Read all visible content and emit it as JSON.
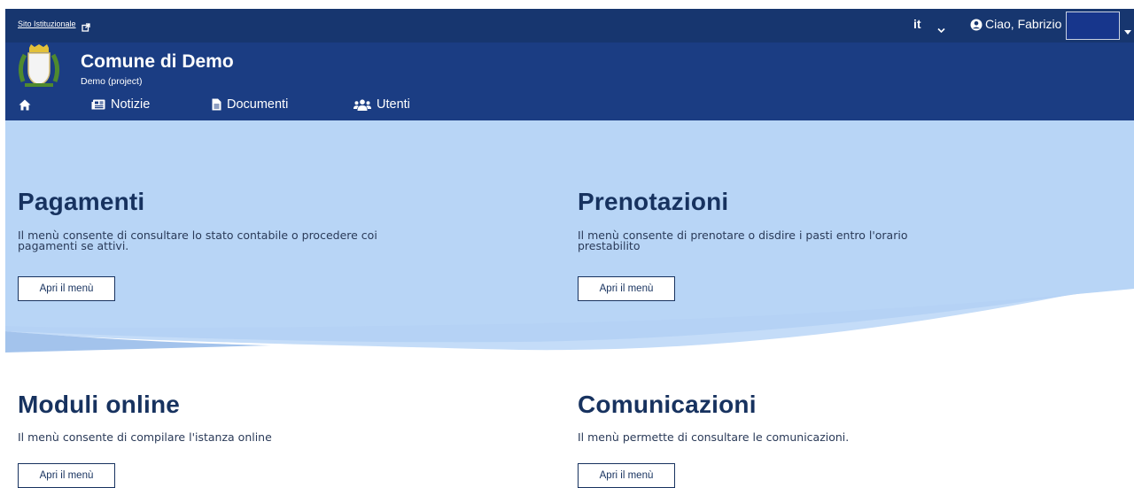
{
  "topbar": {
    "institutional_link": "Sito Istituzionale",
    "language": "it",
    "greeting": "Ciao, Fabrizio"
  },
  "header": {
    "title": "Comune di Demo",
    "subtitle": "Demo (project)",
    "nav": [
      {
        "label": "Notizie",
        "icon": "newspaper-icon"
      },
      {
        "label": "Documenti",
        "icon": "document-icon"
      },
      {
        "label": "Utenti",
        "icon": "users-icon"
      }
    ]
  },
  "cards": [
    {
      "title": "Pagamenti",
      "description_line1": "Il menù consente di consultare lo stato contabile o procedere coi",
      "description_line2": "pagamenti se attivi.",
      "button": "Apri il menù"
    },
    {
      "title": "Prenotazioni",
      "description_line1": "Il menù consente di prenotare o disdire i pasti entro l'orario",
      "description_line2": "prestabilito",
      "button": "Apri il menù"
    },
    {
      "title": "Moduli online",
      "description_line1": "Il menù consente di compilare l'istanza online",
      "description_line2": "",
      "button": "Apri il menù"
    },
    {
      "title": "Comunicazioni",
      "description_line1": "Il menù permette di consultare le comunicazioni.",
      "description_line2": "",
      "button": "Apri il menù"
    }
  ],
  "colors": {
    "top_bar": "#17366f",
    "header": "#1b3d83",
    "hero_light": "#c4dcf8",
    "hero_mid": "#b3d1f5",
    "text_dark": "#17325f"
  }
}
